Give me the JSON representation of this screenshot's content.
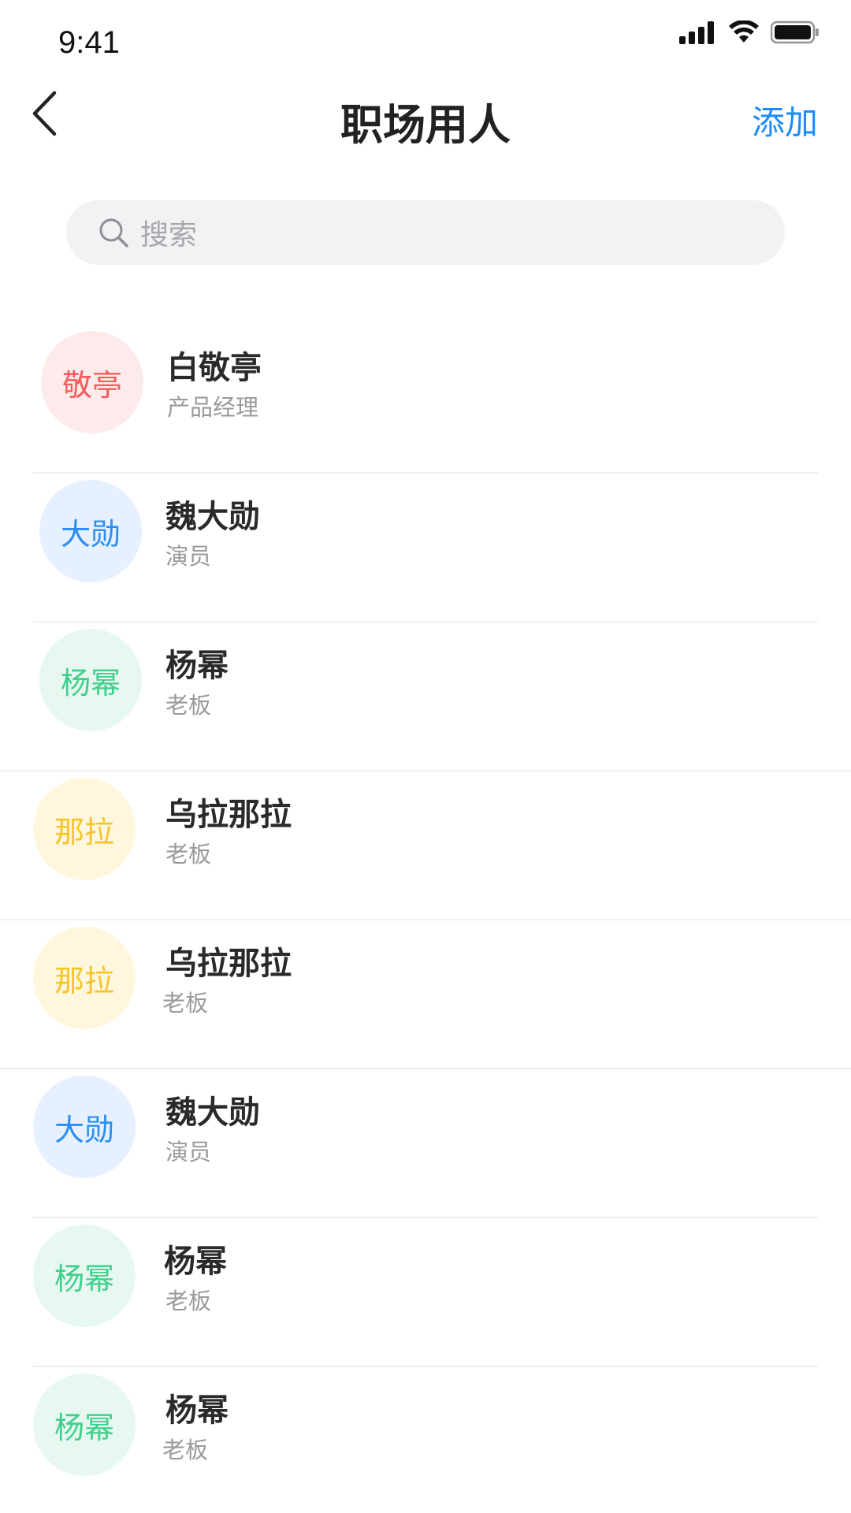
{
  "status_bar": {
    "time": "9:41"
  },
  "nav": {
    "title": "职场用人",
    "add_label": "添加"
  },
  "search": {
    "placeholder": "搜索"
  },
  "contacts": [
    {
      "avatar_text": "敬亭",
      "name": "白敬亭",
      "role": "产品经理",
      "color": "#f45b5b",
      "bg": "#fdeaea"
    },
    {
      "avatar_text": "大勋",
      "name": "魏大勋",
      "role": "演员",
      "color": "#2b8ef0",
      "bg": "#e6f0ff"
    },
    {
      "avatar_text": "杨幂",
      "name": "杨幂",
      "role": "老板",
      "color": "#3fcf8c",
      "bg": "#e6f8f0"
    },
    {
      "avatar_text": "那拉",
      "name": "乌拉那拉",
      "role": "老板",
      "color": "#f5c42c",
      "bg": "#fff7dd"
    },
    {
      "avatar_text": "那拉",
      "name": "乌拉那拉",
      "role": "老板",
      "color": "#f5c42c",
      "bg": "#fff7dd"
    },
    {
      "avatar_text": "大勋",
      "name": "魏大勋",
      "role": "演员",
      "color": "#2b8ef0",
      "bg": "#e6f0ff"
    },
    {
      "avatar_text": "杨幂",
      "name": "杨幂",
      "role": "老板",
      "color": "#3fcf8c",
      "bg": "#e6f8f0"
    },
    {
      "avatar_text": "杨幂",
      "name": "杨幂",
      "role": "老板",
      "color": "#3fcf8c",
      "bg": "#e6f8f0"
    }
  ],
  "colors": {
    "accent": "#1a8cff",
    "title": "#222222",
    "secondary_text": "#9a9a9a",
    "search_bg": "#f2f2f4"
  }
}
